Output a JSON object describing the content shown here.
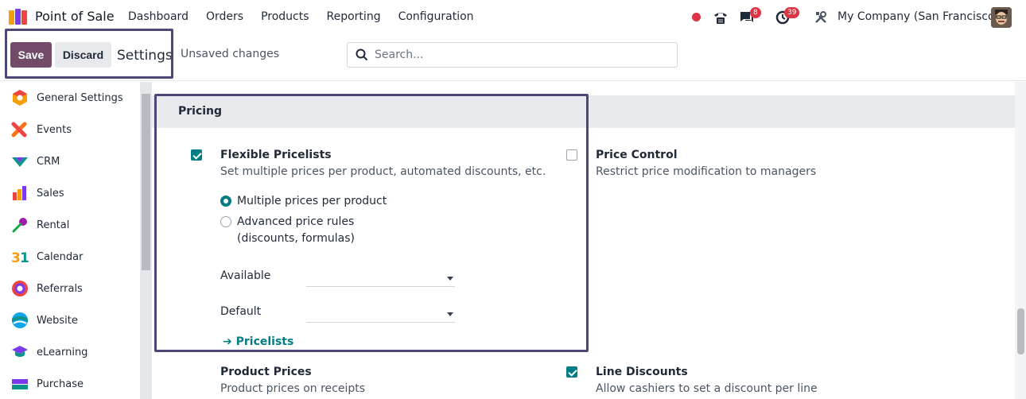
{
  "navbar": {
    "app_name": "Point of Sale",
    "menu": [
      "Dashboard",
      "Orders",
      "Products",
      "Reporting",
      "Configuration"
    ],
    "messages_badge": "8",
    "activities_badge": "39",
    "company": "My Company (San Francisco)"
  },
  "control": {
    "save_label": "Save",
    "discard_label": "Discard",
    "title": "Settings",
    "status": "Unsaved changes",
    "search_placeholder": "Search..."
  },
  "sidebar": {
    "items": [
      {
        "label": "General Settings",
        "icon": "general-settings-icon"
      },
      {
        "label": "Events",
        "icon": "events-icon"
      },
      {
        "label": "CRM",
        "icon": "crm-icon"
      },
      {
        "label": "Sales",
        "icon": "sales-icon"
      },
      {
        "label": "Rental",
        "icon": "rental-icon"
      },
      {
        "label": "Calendar",
        "icon": "calendar-icon"
      },
      {
        "label": "Referrals",
        "icon": "referrals-icon"
      },
      {
        "label": "Website",
        "icon": "website-icon"
      },
      {
        "label": "eLearning",
        "icon": "elearning-icon"
      },
      {
        "label": "Purchase",
        "icon": "purchase-icon"
      }
    ]
  },
  "pricing": {
    "section_title": "Pricing",
    "flexible": {
      "title": "Flexible Pricelists",
      "desc": "Set multiple prices per product, automated discounts, etc.",
      "checked": true,
      "option1": "Multiple prices per product",
      "option2_line1": "Advanced price rules",
      "option2_line2": "(discounts, formulas)",
      "available_label": "Available",
      "default_label": "Default",
      "link": "Pricelists"
    },
    "price_control": {
      "title": "Price Control",
      "desc": "Restrict price modification to managers",
      "checked": false
    },
    "product_prices": {
      "title": "Product Prices",
      "desc": "Product prices on receipts"
    },
    "line_discounts": {
      "title": "Line Discounts",
      "desc": "Allow cashiers to set a discount per line",
      "checked": true
    }
  },
  "colors": {
    "brand": "#714b67",
    "accent": "#017e84",
    "highlight": "#4b4777"
  }
}
